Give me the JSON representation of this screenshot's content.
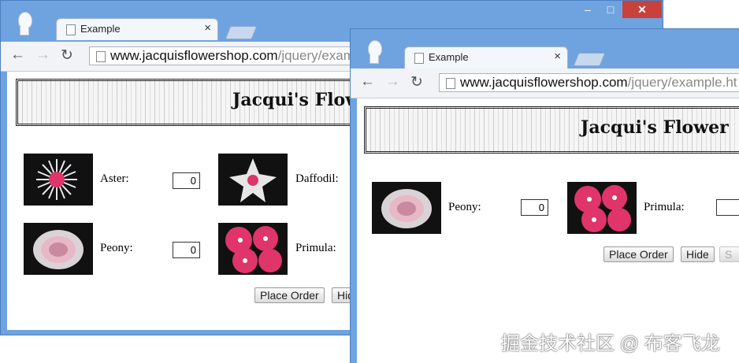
{
  "browser": {
    "tab_title": "Example",
    "tab_close": "×",
    "controls": {
      "minimize": "–",
      "maximize": "□",
      "close": "✕"
    },
    "nav": {
      "back": "←",
      "forward": "→",
      "reload": "↻"
    },
    "url_host_1": "www.jacquisflowershop.com",
    "url_path_1": "/jquery/exam",
    "url_host_2": "www.jacquisflowershop.com",
    "url_path_2": "/jquery/example.ht"
  },
  "page": {
    "banner_title_1": "Jacqui's Flow",
    "banner_title_2": "Jacqui's Flower"
  },
  "window1": {
    "flowers": [
      {
        "label": "Aster:",
        "qty": "0",
        "icon": "aster-image"
      },
      {
        "label": "Daffodil:",
        "icon": "daffodil-image"
      },
      {
        "label": "Peony:",
        "qty": "0",
        "icon": "peony-image"
      },
      {
        "label": "Primula:",
        "icon": "primula-image"
      }
    ],
    "place_order": "Place Order",
    "hide": "Hid"
  },
  "window2": {
    "flowers": [
      {
        "label": "Peony:",
        "qty": "0",
        "icon": "peony-image"
      },
      {
        "label": "Primula:",
        "icon": "primula-image"
      }
    ],
    "place_order": "Place Order",
    "hide": "Hide",
    "show": "S"
  },
  "watermark": "掘金技术社区 @ 布客飞龙",
  "colors": {
    "frame": "#6fa3e0",
    "close_btn": "#c8413b",
    "flower_pink": "#e0356a"
  }
}
